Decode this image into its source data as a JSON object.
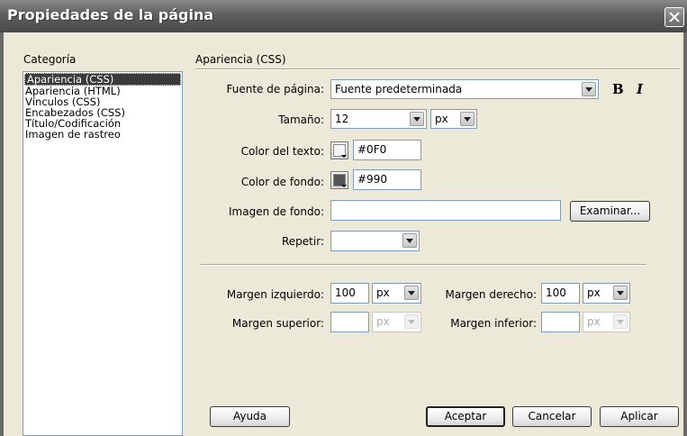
{
  "window": {
    "title": "Propiedades de la página"
  },
  "category": {
    "heading": "Categoría",
    "items": [
      "Apariencia (CSS)",
      "Apariencia (HTML)",
      "Vínculos (CSS)",
      "Encabezados (CSS)",
      "Título/Codificación",
      "Imagen de rastreo"
    ],
    "selected": "Apariencia (CSS)"
  },
  "panel": {
    "heading": "Apariencia (CSS)",
    "font_label": "Fuente de página:",
    "font_value": "Fuente predeterminada",
    "bold_label": "B",
    "italic_label": "I",
    "size_label": "Tamaño:",
    "size_value": "12",
    "size_unit": "px",
    "text_color_label": "Color del texto:",
    "text_color_value": "#0F0",
    "bg_color_label": "Color de fondo:",
    "bg_color_value": "#990",
    "bg_image_label": "Imagen de fondo:",
    "bg_image_value": "",
    "browse_label": "Examinar...",
    "repeat_label": "Repetir:",
    "repeat_value": "",
    "margin_left_label": "Margen izquierdo:",
    "margin_left_value": "100",
    "margin_left_unit": "px",
    "margin_right_label": "Margen derecho:",
    "margin_right_value": "100",
    "margin_right_unit": "px",
    "margin_top_label": "Margen superior:",
    "margin_top_value": "",
    "margin_top_unit": "px",
    "margin_bottom_label": "Margen inferior:",
    "margin_bottom_value": "",
    "margin_bottom_unit": "px"
  },
  "buttons": {
    "help": "Ayuda",
    "ok": "Aceptar",
    "cancel": "Cancelar",
    "apply": "Aplicar"
  },
  "colors": {
    "text_color_swatch": "#f4f4f4",
    "bg_color_swatch": "#555555"
  }
}
